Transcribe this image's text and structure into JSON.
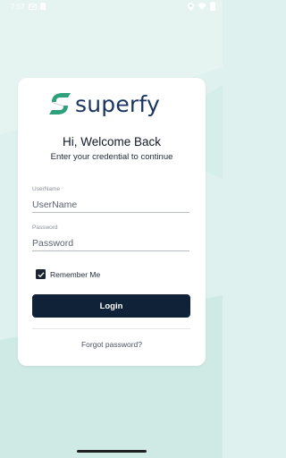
{
  "status_bar": {
    "time": "7:57",
    "icons": [
      "gmail-icon",
      "sd-card-icon",
      "location-icon",
      "wifi-icon",
      "battery-icon"
    ]
  },
  "brand": {
    "name": "superfy",
    "logo_icon": "superfy-logo-icon",
    "colors": {
      "primary": "#1a3560",
      "mark": "#2ea07b",
      "button": "#0f2238"
    }
  },
  "login": {
    "heading": "Hi, Welcome Back",
    "subheading": "Enter your credential to continue",
    "username": {
      "label": "UserName",
      "placeholder": "UserName",
      "value": ""
    },
    "password": {
      "label": "Password",
      "placeholder": "Password",
      "value": ""
    },
    "remember_me": {
      "label": "Remember Me",
      "checked": true
    },
    "login_button": "Login",
    "forgot_password": "Forgot password?"
  }
}
